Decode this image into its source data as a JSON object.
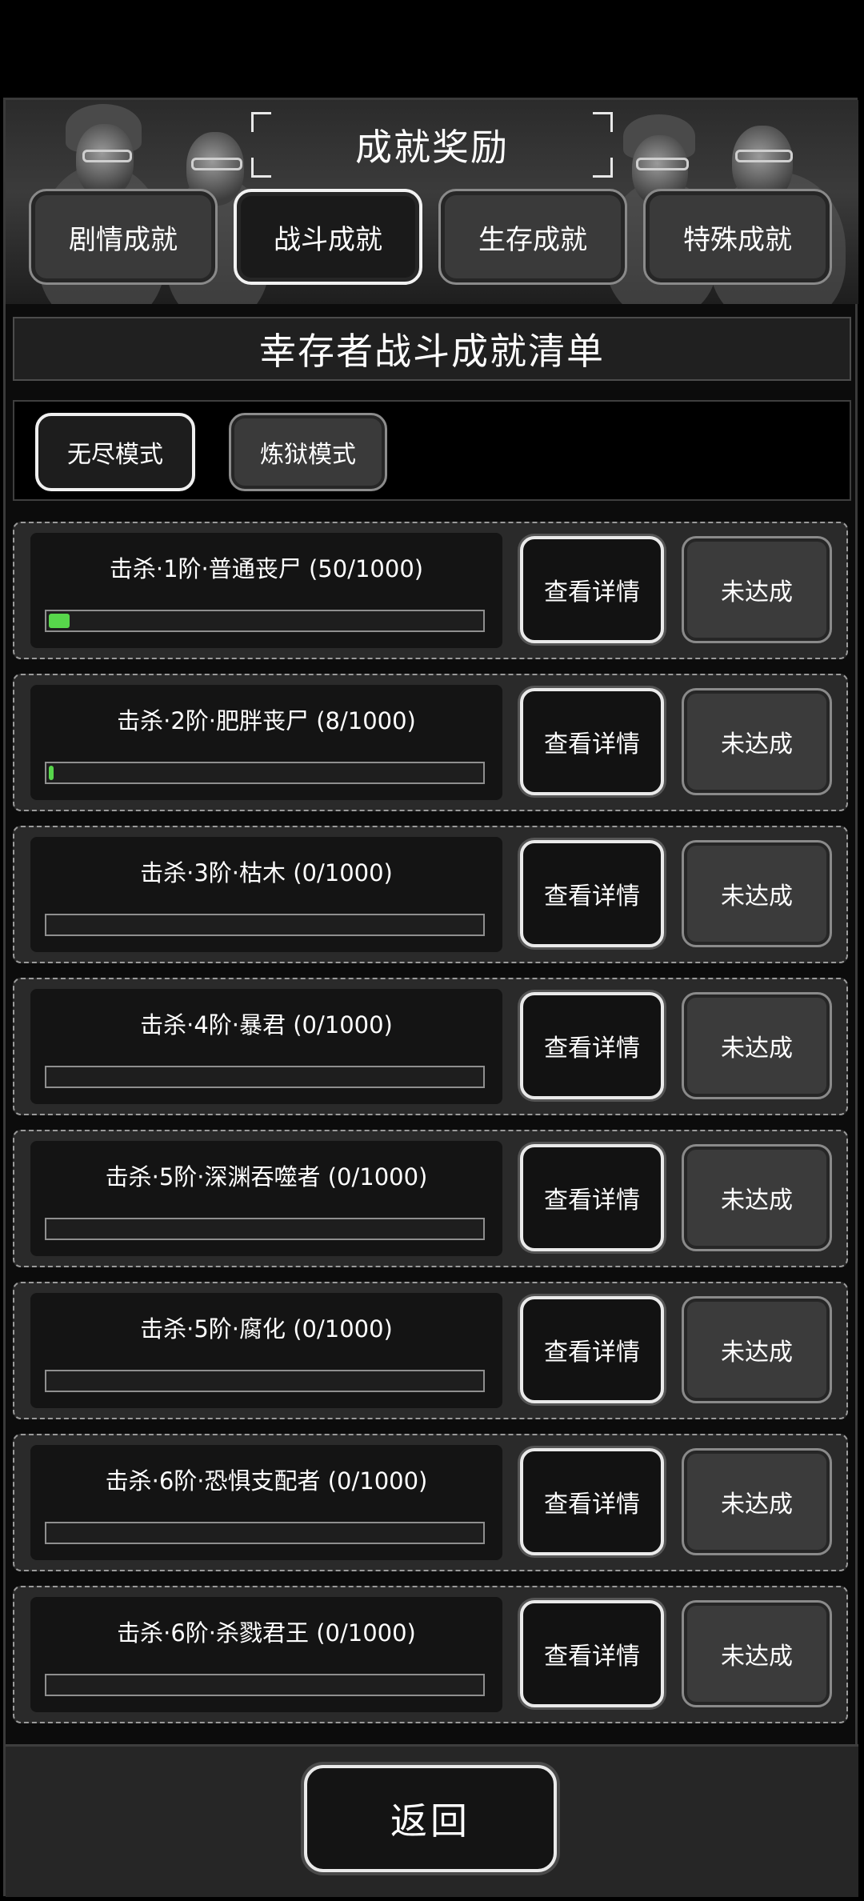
{
  "header": {
    "title": "成就奖励"
  },
  "tabs": [
    {
      "label": "剧情成就",
      "active": false
    },
    {
      "label": "战斗成就",
      "active": true
    },
    {
      "label": "生存成就",
      "active": false
    },
    {
      "label": "特殊成就",
      "active": false
    }
  ],
  "subtitle": "幸存者战斗成就清单",
  "modes": [
    {
      "label": "无尽模式",
      "active": true
    },
    {
      "label": "炼狱模式",
      "active": false
    }
  ],
  "achievements": [
    {
      "name": "击杀·1阶·普通丧尸 (50/1000)",
      "progress": 0.05,
      "detail_label": "查看详情",
      "status_label": "未达成"
    },
    {
      "name": "击杀·2阶·肥胖丧尸 (8/1000)",
      "progress": 0.008,
      "detail_label": "查看详情",
      "status_label": "未达成"
    },
    {
      "name": "击杀·3阶·枯木 (0/1000)",
      "progress": 0,
      "detail_label": "查看详情",
      "status_label": "未达成"
    },
    {
      "name": "击杀·4阶·暴君 (0/1000)",
      "progress": 0,
      "detail_label": "查看详情",
      "status_label": "未达成"
    },
    {
      "name": "击杀·5阶·深渊吞噬者 (0/1000)",
      "progress": 0,
      "detail_label": "查看详情",
      "status_label": "未达成"
    },
    {
      "name": "击杀·5阶·腐化 (0/1000)",
      "progress": 0,
      "detail_label": "查看详情",
      "status_label": "未达成"
    },
    {
      "name": "击杀·6阶·恐惧支配者 (0/1000)",
      "progress": 0,
      "detail_label": "查看详情",
      "status_label": "未达成"
    },
    {
      "name": "击杀·6阶·杀戮君王 (0/1000)",
      "progress": 0,
      "detail_label": "查看详情",
      "status_label": "未达成"
    }
  ],
  "footer": {
    "back_label": "返回"
  },
  "colors": {
    "progress_fill": "#57d64b"
  }
}
